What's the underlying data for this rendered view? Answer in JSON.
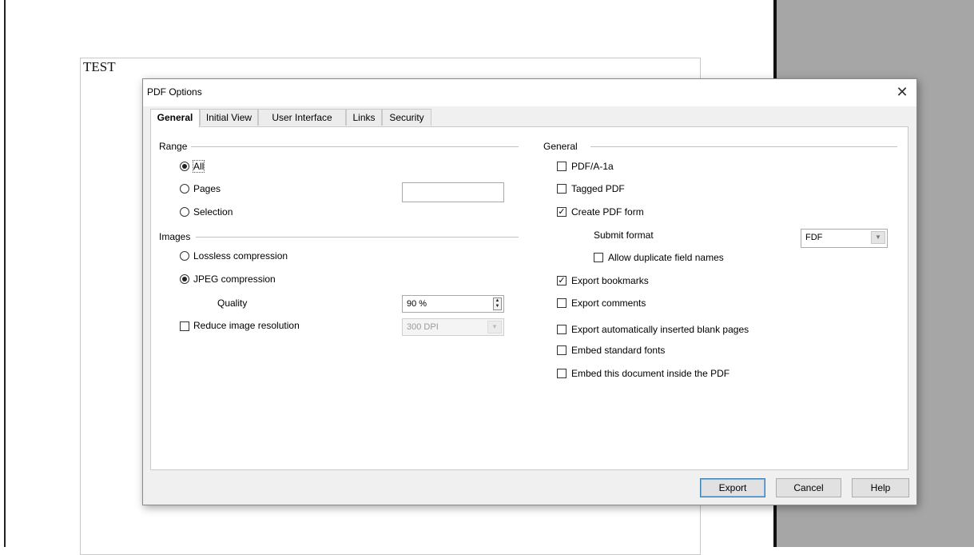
{
  "document": {
    "text": "TEST"
  },
  "dialog": {
    "title": "PDF Options",
    "close_glyph": "✕",
    "tabs": [
      {
        "label": "General",
        "active": true
      },
      {
        "label": "Initial View",
        "active": false
      },
      {
        "label": "User Interface",
        "active": false
      },
      {
        "label": "Links",
        "active": false
      },
      {
        "label": "Security",
        "active": false
      }
    ],
    "range": {
      "heading": "Range",
      "options": [
        {
          "label": "All",
          "checked": true
        },
        {
          "label": "Pages",
          "checked": false
        },
        {
          "label": "Selection",
          "checked": false
        }
      ],
      "pages_value": ""
    },
    "images": {
      "heading": "Images",
      "lossless_label": "Lossless compression",
      "lossless_checked": false,
      "jpeg_label": "JPEG compression",
      "jpeg_checked": true,
      "quality_label": "Quality",
      "quality_value": "90 %",
      "reduce_label": "Reduce image resolution",
      "reduce_checked": false,
      "resolution_value": "300 DPI"
    },
    "general": {
      "heading": "General",
      "pdfa_label": "PDF/A-1a",
      "pdfa_checked": false,
      "tagged_label": "Tagged PDF",
      "tagged_checked": false,
      "create_form_label": "Create PDF form",
      "create_form_checked": true,
      "submit_format_label": "Submit format",
      "submit_format_value": "FDF",
      "allow_dup_label": "Allow duplicate field names",
      "allow_dup_checked": false,
      "bookmarks_label": "Export bookmarks",
      "bookmarks_checked": true,
      "comments_label": "Export comments",
      "comments_checked": false,
      "blank_pages_label": "Export automatically inserted blank pages",
      "blank_pages_checked": false,
      "embed_fonts_label": "Embed standard fonts",
      "embed_fonts_checked": false,
      "embed_doc_label": "Embed this document inside the PDF",
      "embed_doc_checked": false
    },
    "buttons": {
      "export": "Export",
      "cancel": "Cancel",
      "help": "Help"
    }
  }
}
